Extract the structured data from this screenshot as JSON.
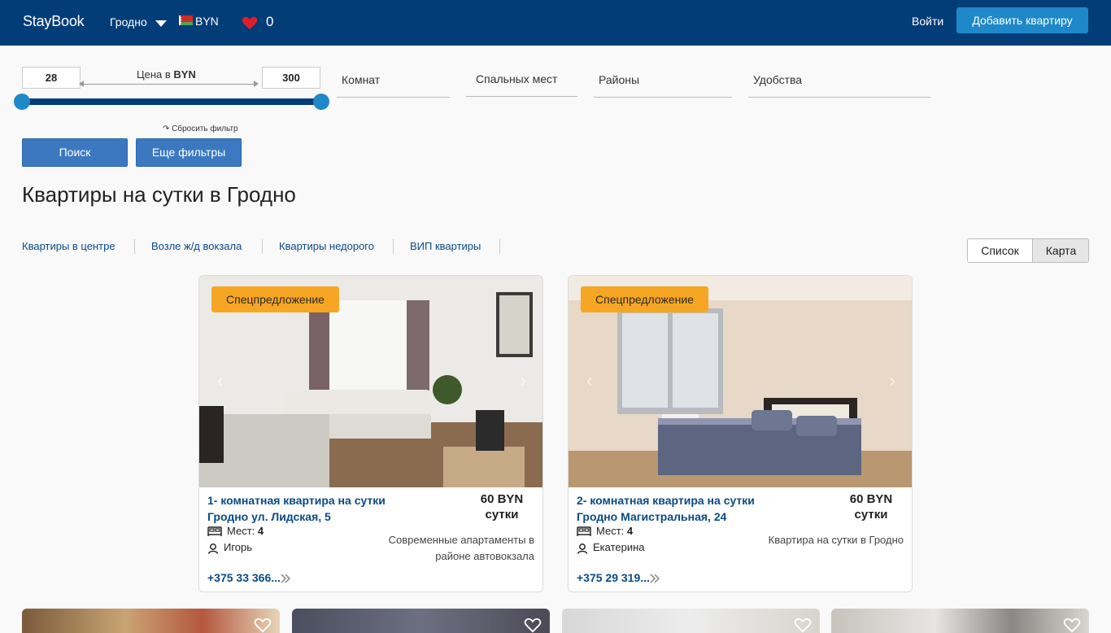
{
  "header": {
    "logo": "StayBook",
    "city": "Гродно",
    "currency": "BYN",
    "favorites_count": "0",
    "login": "Войти",
    "add_apartment": "Добавить квартиру"
  },
  "filters": {
    "price_min": "28",
    "price_max": "300",
    "price_label_prefix": "Цена в",
    "price_label_currency": "BYN",
    "rooms": "Комнат",
    "beds": "Спальных мест",
    "districts": "Районы",
    "amenities": "Удобства",
    "reset": "↷ Сбросить фильтр",
    "search_button": "Поиск",
    "more_filters_button": "Еще фильтры"
  },
  "page_title": "Квартиры на сутки в Гродно",
  "quick_links": [
    "Квартиры в центре",
    "Возле ж/д вокзала",
    "Квартиры недорого",
    "ВИП квартиры"
  ],
  "view_toggle": {
    "list": "Список",
    "map": "Карта"
  },
  "listings": [
    {
      "badge": "Спецпредложение",
      "title_line1": "1- комнатная квартира на сутки",
      "title_line2": "Гродно ул. Лидская, 5",
      "price": "60 BYN",
      "price_unit": "сутки",
      "places_label": "Мест:",
      "places": "4",
      "owner": "Игорь",
      "description": "Современные апартаменты в районе автовокзала",
      "phone": "+375 33 366..."
    },
    {
      "badge": "Спецпредложение",
      "title_line1": "2- комнатная квартира на сутки",
      "title_line2": "Гродно Магистральная, 24",
      "price": "60 BYN",
      "price_unit": "сутки",
      "places_label": "Мест:",
      "places": "4",
      "owner": "Екатерина",
      "description": "Квартира на сутки в Гродно",
      "phone": "+375 29 319..."
    }
  ],
  "colors": {
    "header_bg": "#033d78",
    "accent_blue": "#1f88c9",
    "button_blue": "#3b78c0",
    "badge_orange": "#f7a623",
    "link_blue": "#0b4a86",
    "favorite_red": "#e01e2b"
  },
  "icons": {
    "favorites": "heart-icon",
    "city_dropdown": "caret-down-icon",
    "flag": "belarus-flag-icon",
    "beds": "bed-icon",
    "owner": "user-icon",
    "phone_more": "double-chevron-right-icon",
    "carousel_prev": "chevron-left-icon",
    "carousel_next": "chevron-right-icon"
  }
}
